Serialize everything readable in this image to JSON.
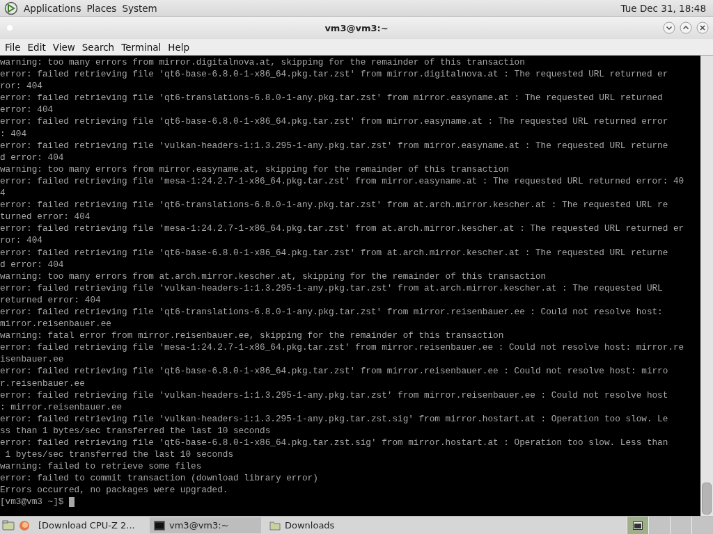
{
  "top_panel": {
    "menus": [
      "Applications",
      "Places",
      "System"
    ],
    "clock": "Tue Dec 31, 18:48"
  },
  "window": {
    "title": "vm3@vm3:~"
  },
  "menubar": [
    "File",
    "Edit",
    "View",
    "Search",
    "Terminal",
    "Help"
  ],
  "terminal": {
    "lines": [
      "warning: too many errors from mirror.digitalnova.at, skipping for the remainder of this transaction",
      "error: failed retrieving file 'qt6-base-6.8.0-1-x86_64.pkg.tar.zst' from mirror.digitalnova.at : The requested URL returned er",
      "ror: 404",
      "error: failed retrieving file 'qt6-translations-6.8.0-1-any.pkg.tar.zst' from mirror.easyname.at : The requested URL returned",
      "error: 404",
      "error: failed retrieving file 'qt6-base-6.8.0-1-x86_64.pkg.tar.zst' from mirror.easyname.at : The requested URL returned error",
      ": 404",
      "error: failed retrieving file 'vulkan-headers-1:1.3.295-1-any.pkg.tar.zst' from mirror.easyname.at : The requested URL returne",
      "d error: 404",
      "warning: too many errors from mirror.easyname.at, skipping for the remainder of this transaction",
      "error: failed retrieving file 'mesa-1:24.2.7-1-x86_64.pkg.tar.zst' from mirror.easyname.at : The requested URL returned error: 40",
      "4",
      "error: failed retrieving file 'qt6-translations-6.8.0-1-any.pkg.tar.zst' from at.arch.mirror.kescher.at : The requested URL re",
      "turned error: 404",
      "error: failed retrieving file 'mesa-1:24.2.7-1-x86_64.pkg.tar.zst' from at.arch.mirror.kescher.at : The requested URL returned er",
      "ror: 404",
      "error: failed retrieving file 'qt6-base-6.8.0-1-x86_64.pkg.tar.zst' from at.arch.mirror.kescher.at : The requested URL returne",
      "d error: 404",
      "warning: too many errors from at.arch.mirror.kescher.at, skipping for the remainder of this transaction",
      "error: failed retrieving file 'vulkan-headers-1:1.3.295-1-any.pkg.tar.zst' from at.arch.mirror.kescher.at : The requested URL",
      "returned error: 404",
      "error: failed retrieving file 'qt6-translations-6.8.0-1-any.pkg.tar.zst' from mirror.reisenbauer.ee : Could not resolve host:",
      "mirror.reisenbauer.ee",
      "warning: fatal error from mirror.reisenbauer.ee, skipping for the remainder of this transaction",
      "error: failed retrieving file 'mesa-1:24.2.7-1-x86_64.pkg.tar.zst' from mirror.reisenbauer.ee : Could not resolve host: mirror.re",
      "isenbauer.ee",
      "error: failed retrieving file 'qt6-base-6.8.0-1-x86_64.pkg.tar.zst' from mirror.reisenbauer.ee : Could not resolve host: mirro",
      "r.reisenbauer.ee",
      "error: failed retrieving file 'vulkan-headers-1:1.3.295-1-any.pkg.tar.zst' from mirror.reisenbauer.ee : Could not resolve host",
      ": mirror.reisenbauer.ee",
      "error: failed retrieving file 'vulkan-headers-1:1.3.295-1-any.pkg.tar.zst.sig' from mirror.hostart.at : Operation too slow. Le",
      "ss than 1 bytes/sec transferred the last 10 seconds",
      "error: failed retrieving file 'qt6-base-6.8.0-1-x86_64.pkg.tar.zst.sig' from mirror.hostart.at : Operation too slow. Less than",
      " 1 bytes/sec transferred the last 10 seconds",
      "warning: failed to retrieve some files",
      "error: failed to commit transaction (download library error)",
      "Errors occurred, no packages were upgraded."
    ],
    "prompt": "[vm3@vm3 ~]$"
  },
  "taskbar": {
    "items": [
      {
        "kind": "browser",
        "label": "[Download CPU-Z 2...",
        "selected": false
      },
      {
        "kind": "terminal",
        "label": "vm3@vm3:~",
        "selected": true
      },
      {
        "kind": "folder",
        "label": "Downloads",
        "selected": false
      }
    ],
    "workspaces": [
      {
        "selected": true
      },
      {
        "selected": false
      },
      {
        "selected": false
      },
      {
        "selected": false
      }
    ]
  }
}
